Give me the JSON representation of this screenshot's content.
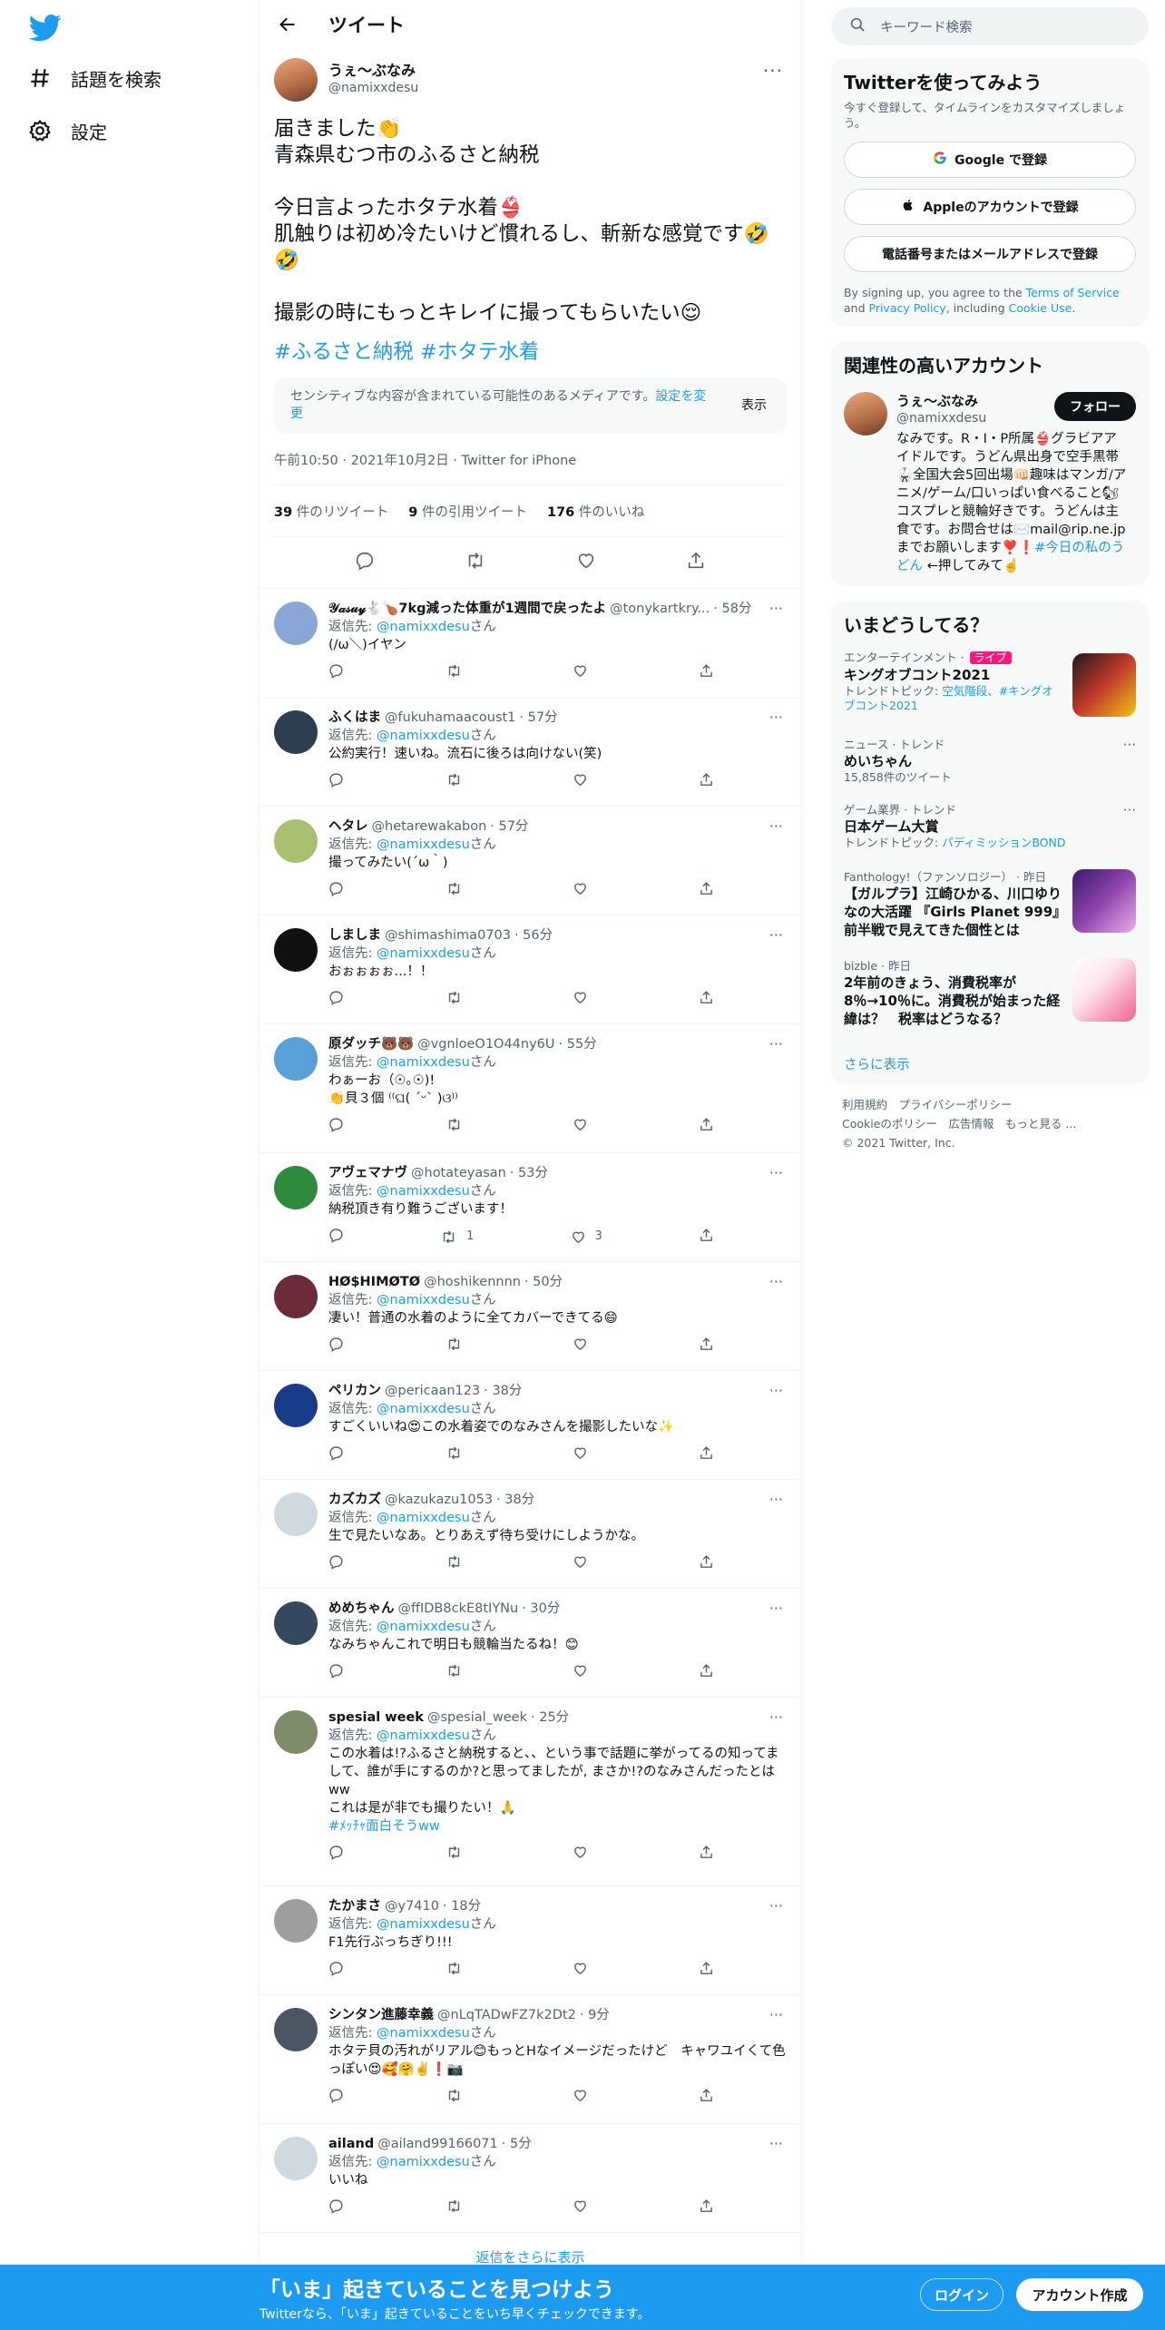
{
  "nav": {
    "explore": "話題を検索",
    "settings": "設定"
  },
  "header": {
    "title": "ツイート"
  },
  "main_tweet": {
    "name": "うぇ〜ぶなみ",
    "handle": "@namixxdesu",
    "text": "届きました👏\n青森県むつ市のふるさと納税\n\n今日言よったホタテ水着👙\n肌触りは初め冷たいけど慣れるし、斬新な感覚です🤣🤣\n\n撮影の時にもっとキレイに撮ってもらいたい😌",
    "hashtags": "#ふるさと納税 #ホタテ水着",
    "sensitive_text": "センシティブな内容が含まれている可能性のあるメディアです。",
    "sensitive_link": "設定を変更",
    "sensitive_show": "表示",
    "meta": "午前10:50 · 2021年10月2日 · Twitter for iPhone",
    "retweets": "39",
    "retweets_label": "件のリツイート",
    "quotes": "9",
    "quotes_label": "件の引用ツイート",
    "likes": "176",
    "likes_label": "件のいいね"
  },
  "reply_prefix": "返信先: ",
  "reply_suffix": "さん",
  "replies": [
    {
      "name": "𝒴𝒶𝓈𝓊𝓎🐇🍗7kg減った体重が1週間で戻ったよ",
      "handle": "@tonykartkry...",
      "time": "· 58分",
      "to": "@namixxdesu",
      "text": "(/ω＼)イヤン",
      "rt": "",
      "like": ""
    },
    {
      "name": "ふくはま",
      "handle": "@fukuhamaacoust1",
      "time": "· 57分",
      "to": "@namixxdesu",
      "text": "公約実行！速いね。流石に後ろは向けない(笑)",
      "rt": "",
      "like": ""
    },
    {
      "name": "ヘタレ",
      "handle": "@hetarewakabon",
      "time": "· 57分",
      "to": "@namixxdesu",
      "text": "撮ってみたい(´ω｀)",
      "rt": "",
      "like": ""
    },
    {
      "name": "しましま",
      "handle": "@shimashima0703",
      "time": "· 56分",
      "to": "@namixxdesu",
      "text": "おぉぉぉぉ...！！",
      "rt": "",
      "like": ""
    },
    {
      "name": "原ダッチ🐻🐻",
      "handle": "@vgnloeO1O44ny6U",
      "time": "· 55分",
      "to": "@namixxdesu",
      "text": "わぁーお（☉｡☉)!\n👏貝３個  ⁽⁽ଘ( ˊᵕˋ )ଓ⁾⁾",
      "rt": "",
      "like": ""
    },
    {
      "name": "アヴェマナヴ",
      "handle": "@hotateyasan",
      "time": "· 53分",
      "to": "@namixxdesu",
      "text": "納税頂き有り難うございます！",
      "rt": "1",
      "like": "3"
    },
    {
      "name": "HØ$HIMØTØ",
      "handle": "@hoshikennnn",
      "time": "· 50分",
      "to": "@namixxdesu",
      "text": "凄い！普通の水着のように全てカバーできてる😄",
      "rt": "",
      "like": ""
    },
    {
      "name": "ペリカン",
      "handle": "@pericaan123",
      "time": "· 38分",
      "to": "@namixxdesu",
      "text": "すごくいいね😍この水着姿でのなみさんを撮影したいな✨",
      "rt": "",
      "like": ""
    },
    {
      "name": "カズカズ",
      "handle": "@kazukazu1053",
      "time": "· 38分",
      "to": "@namixxdesu",
      "text": "生で見たいなあ。とりあえず待ち受けにしようかな。",
      "rt": "",
      "like": ""
    },
    {
      "name": "めめちゃん",
      "handle": "@ffIDB8ckE8tIYNu",
      "time": "· 30分",
      "to": "@namixxdesu",
      "text": "なみちゃんこれで明日も競輪当たるね！😊",
      "rt": "",
      "like": ""
    },
    {
      "name": "spesial week",
      "handle": "@spesial_week",
      "time": "· 25分",
      "to": "@namixxdesu",
      "text": "この水着は!?ふるさと納税すると、、という事で話題に挙がってるの知ってまして、誰が手にするのか?と思ってましたが, まさか!?のなみさんだったとはww\nこれは是が非でも撮りたい！🙏",
      "hashtag": "#ﾒｯﾁｬ面白そうww",
      "rt": "",
      "like": ""
    },
    {
      "name": "たかまさ",
      "handle": "@y7410",
      "time": "· 18分",
      "to": "@namixxdesu",
      "text": "F1先行ぶっちぎり!!!",
      "rt": "",
      "like": ""
    },
    {
      "name": "シンタン進藤幸義",
      "handle": "@nLqTADwFZ7k2Dt2",
      "time": "· 9分",
      "to": "@namixxdesu",
      "text": "ホタテ貝の汚れがリアル😊もっとHなイメージだったけど　キャワユイくて色っぽい😍🥰🤗✌️❗📷",
      "rt": "",
      "like": ""
    },
    {
      "name": "ailand",
      "handle": "@ailand99166071",
      "time": "· 5分",
      "to": "@namixxdesu",
      "text": "いいね",
      "rt": "",
      "like": ""
    }
  ],
  "more_replies": "返信をさらに表示",
  "search": {
    "placeholder": "キーワード検索"
  },
  "join": {
    "title": "Twitterを使ってみよう",
    "sub": "今すぐ登録して、タイムラインをカスタマイズしましょう。",
    "google": "Google で登録",
    "apple": "Appleのアカウントで登録",
    "phone": "電話番号またはメールアドレスで登録",
    "legal_1": "By signing up, you agree to the ",
    "tos": "Terms of Service",
    "legal_2": " and ",
    "privacy": "Privacy Policy",
    "legal_3": ", including ",
    "cookie": "Cookie Use",
    "legal_4": "."
  },
  "related": {
    "title": "関連性の高いアカウント",
    "name": "うぇ〜ぶなみ",
    "handle": "@namixxdesu",
    "follow": "フォロー",
    "bio": "なみです。R・I・P所属👙グラビアアイドルです。うどん県出身で空手黒帯🥋全国大会5回出場👊🏻趣味はマンガ/アニメ/ゲーム/口いっぱい食べること🐿コスプレと競輪好きです。うどんは主食です。お問合せは✉️mail@rip.ne.jp までお願いします❣️❗",
    "bio_tag": "#今日の私のうどん",
    "bio_end": " ←押してみて☝️"
  },
  "trends": {
    "title": "いまどうしてる？",
    "items": [
      {
        "cat": "エンターテインメント · ",
        "live": "ライブ",
        "title": "キングオブコント2021",
        "sub": "トレンドトピック: ",
        "sub_tags": "空気階段、#キングオブコント2021"
      },
      {
        "cat": "ニュース · トレンド",
        "title": "めいちゃん",
        "sub": "15,858件のツイート"
      },
      {
        "cat": "ゲーム業界 · トレンド",
        "title": "日本ゲーム大賞",
        "sub": "トレンドトピック: ",
        "sub_tags": "パディミッションBOND"
      },
      {
        "cat": "Fanthology!（ファンソロジー） · 昨日",
        "title": "【ガルプラ】江崎ひかる、川口ゆりなの大活躍 『Girls Planet 999』前半戦で見えてきた個性とは"
      },
      {
        "cat": "bizble · 昨日",
        "title": "2年前のきょう、消費税率が8％→10％に。消費税が始まった経緯は？　税率はどうなる？"
      }
    ],
    "show_more": "さらに表示"
  },
  "footer": {
    "line1": "利用規約　プライバシーポリシー",
    "line2": "Cookieのポリシー　広告情報　もっと見る ...",
    "line3": "© 2021 Twitter, Inc."
  },
  "bottombar": {
    "title": "「いま」起きていることを見つけよう",
    "sub": "Twitterなら、「いま」起きていることをいち早くチェックできます。",
    "login": "ログイン",
    "signup": "アカウント作成"
  },
  "colors": {
    "accent": "#1d9bf0",
    "live": "#f91880"
  }
}
